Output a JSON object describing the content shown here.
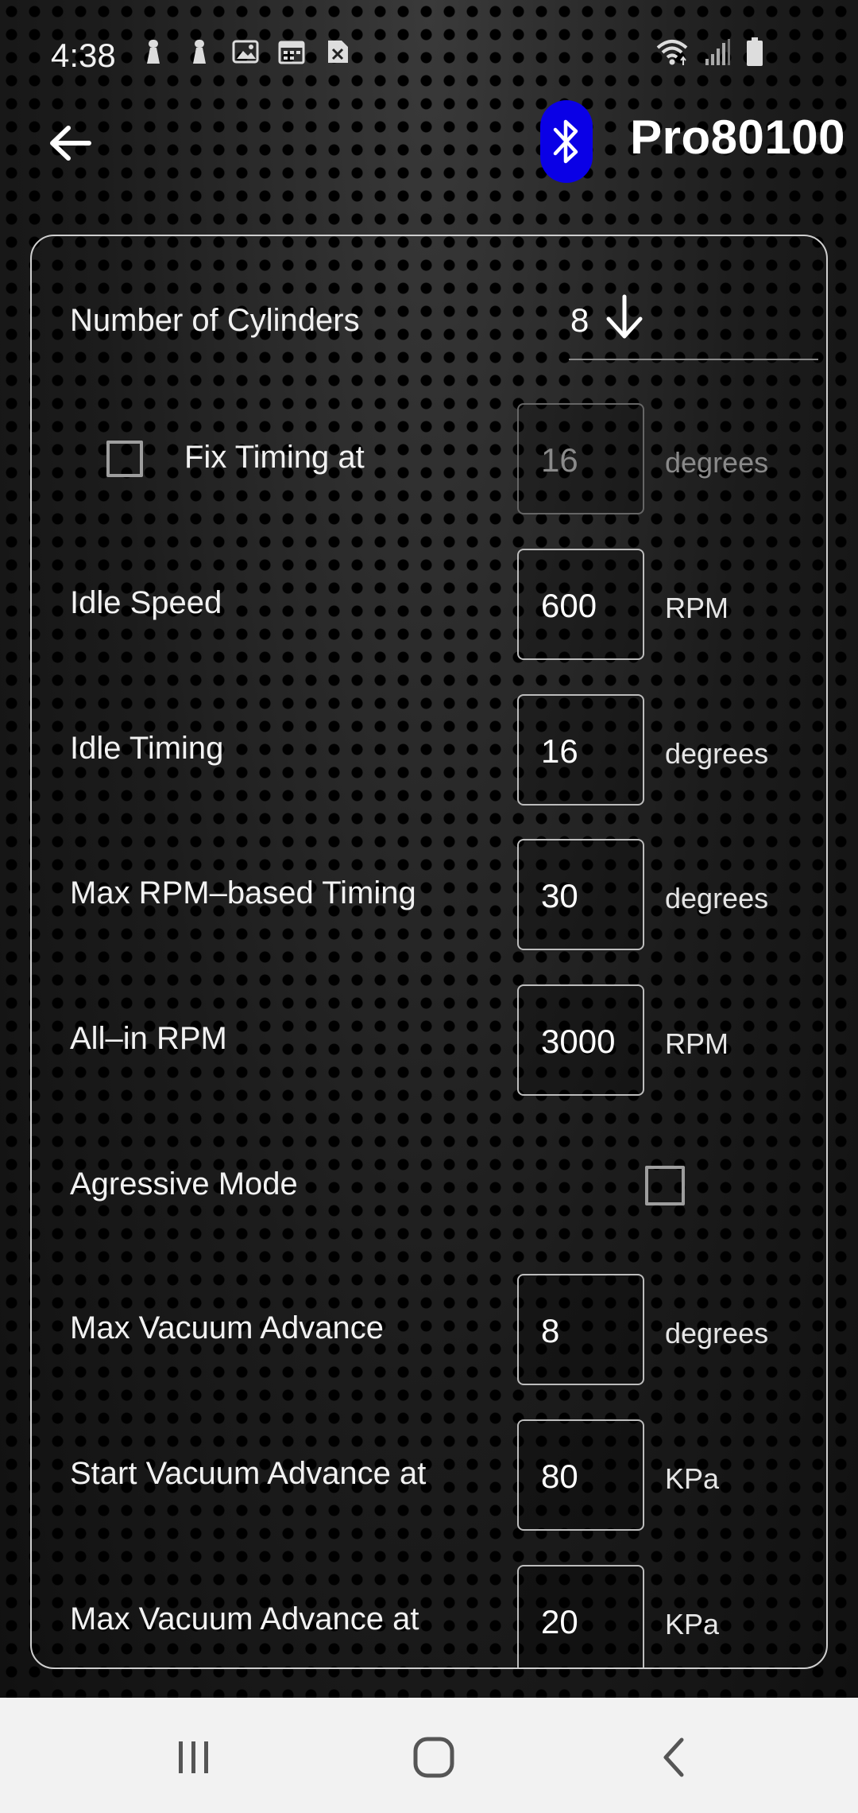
{
  "status_bar": {
    "time": "4:38",
    "icons": [
      "notification-pin-icon",
      "notification-pin-icon",
      "image-icon",
      "calendar-icon",
      "file-error-icon"
    ],
    "right_icons": [
      "wifi-icon",
      "signal-icon",
      "battery-icon"
    ]
  },
  "app_bar": {
    "back_icon": "arrow-left-icon",
    "bluetooth_icon": "bluetooth-icon",
    "bluetooth_color": "#0a00e6",
    "device_name": "Pro80100"
  },
  "settings": {
    "cylinders": {
      "label": "Number of Cylinders",
      "value": "8"
    },
    "fix_timing": {
      "label": "Fix Timing at",
      "value": "16",
      "unit": "degrees",
      "checked": false,
      "enabled": false
    },
    "idle_speed": {
      "label": "Idle Speed",
      "value": "600",
      "unit": "RPM"
    },
    "idle_timing": {
      "label": "Idle Timing",
      "value": "16",
      "unit": "degrees"
    },
    "max_rpm_timing": {
      "label": "Max RPM–based Timing",
      "value": "30",
      "unit": "degrees"
    },
    "all_in_rpm": {
      "label": "All–in RPM",
      "value": "3000",
      "unit": "RPM"
    },
    "aggressive_mode": {
      "label": "Agressive Mode",
      "checked": false
    },
    "max_vacuum_advance": {
      "label": "Max Vacuum Advance",
      "value": "8",
      "unit": "degrees"
    },
    "start_vacuum_advance": {
      "label": "Start Vacuum Advance at",
      "value": "80",
      "unit": "KPa"
    },
    "max_vacuum_advance_at": {
      "label": "Max Vacuum Advance at",
      "value": "20",
      "unit": "KPa"
    }
  },
  "nav_bar": {
    "buttons": [
      "recent-apps-icon",
      "home-icon",
      "back-icon"
    ],
    "background": "#f2f2f2"
  }
}
